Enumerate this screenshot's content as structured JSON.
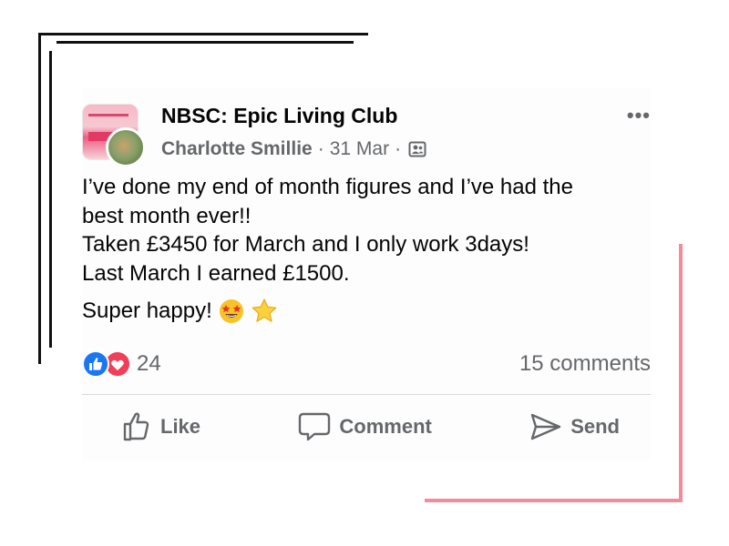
{
  "post": {
    "group_name": "NBSC: Epic Living Club",
    "author": "Charlotte Smillie",
    "separator": "·",
    "date": "31 Mar",
    "more_label": "•••",
    "body_lines": [
      "I’ve done my end of month figures and I’ve had the",
      "best month ever!!",
      "Taken £3450 for March and I only work 3days!",
      "Last March I earned £1500."
    ],
    "closing_line": "Super happy!",
    "icons": {
      "audience": "group-members-icon",
      "emoji_1": "star-struck-emoji",
      "emoji_2": "star-emoji",
      "reaction_1": "like-reaction-icon",
      "reaction_2": "love-reaction-icon"
    }
  },
  "reactions": {
    "count": "24",
    "comments": "15 comments"
  },
  "actions": {
    "like": "Like",
    "comment": "Comment",
    "send": "Send"
  },
  "colors": {
    "like_blue": "#1877f2",
    "love_red": "#f33e58",
    "accent_pink": "#f48b9a",
    "secondary_text": "#65676b"
  }
}
